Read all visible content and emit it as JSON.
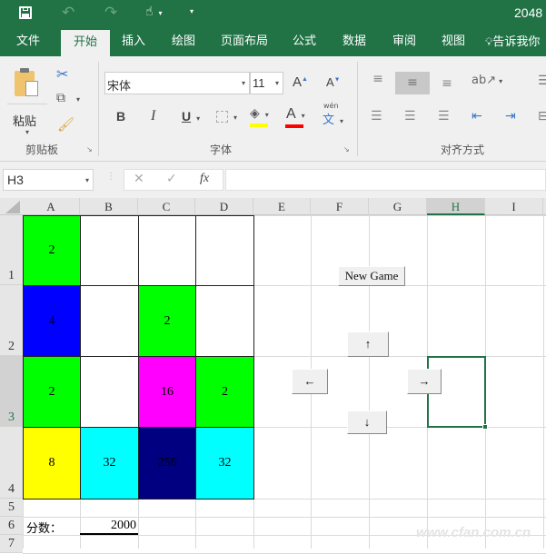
{
  "titlebar": {
    "title": "2048",
    "quick_access": {
      "save_icon": "save-icon",
      "undo_icon": "undo-icon",
      "redo_icon": "redo-icon",
      "touch_icon": "touch-mode-icon",
      "customize_icon": "customize-qat-icon"
    }
  },
  "tabs": [
    {
      "label": "文件"
    },
    {
      "label": "开始",
      "active": true
    },
    {
      "label": "插入"
    },
    {
      "label": "绘图"
    },
    {
      "label": "页面布局"
    },
    {
      "label": "公式"
    },
    {
      "label": "数据"
    },
    {
      "label": "审阅"
    },
    {
      "label": "视图"
    },
    {
      "label": "告诉我你"
    }
  ],
  "ribbon": {
    "clipboard": {
      "label": "剪贴板",
      "paste_label": "粘贴"
    },
    "font": {
      "label": "字体",
      "font_name": "宋体",
      "font_size": "11",
      "bold": "B",
      "italic": "I",
      "underline": "U",
      "grow": "A",
      "shrink": "A",
      "font_color_label": "A",
      "phonetic_top": "wén",
      "phonetic_bottom": "文",
      "fill_color": "#ffff00",
      "font_color": "#ff0000"
    },
    "alignment": {
      "label": "对齐方式"
    }
  },
  "formula_bar": {
    "name_box": "H3",
    "cancel": "✕",
    "enter": "✓",
    "fx": "fx",
    "value": ""
  },
  "columns": [
    "A",
    "B",
    "C",
    "D",
    "E",
    "F",
    "G",
    "H",
    "I"
  ],
  "selected_column": "H",
  "rows": [
    "1",
    "2",
    "3",
    "4",
    "5",
    "6",
    "7"
  ],
  "selected_row": "3",
  "board": [
    [
      {
        "v": "2",
        "c": "#00ff00"
      },
      {
        "v": "",
        "c": "#ffffff"
      },
      {
        "v": "",
        "c": "#ffffff"
      },
      {
        "v": "",
        "c": "#ffffff"
      }
    ],
    [
      {
        "v": "4",
        "c": "#0000ff"
      },
      {
        "v": "",
        "c": "#ffffff"
      },
      {
        "v": "2",
        "c": "#00ff00"
      },
      {
        "v": "",
        "c": "#ffffff"
      }
    ],
    [
      {
        "v": "2",
        "c": "#00ff00"
      },
      {
        "v": "",
        "c": "#ffffff"
      },
      {
        "v": "16",
        "c": "#ff00ff"
      },
      {
        "v": "2",
        "c": "#00ff00"
      }
    ],
    [
      {
        "v": "8",
        "c": "#ffff00"
      },
      {
        "v": "32",
        "c": "#00ffff"
      },
      {
        "v": "256",
        "c": "#000080"
      },
      {
        "v": "32",
        "c": "#00ffff"
      }
    ]
  ],
  "score": {
    "label": "分数：",
    "value": "2000"
  },
  "controls": {
    "new_game": "New Game",
    "up": "↑",
    "down": "↓",
    "left": "←",
    "right": "→"
  },
  "watermark": "www.cfan.com.cn"
}
